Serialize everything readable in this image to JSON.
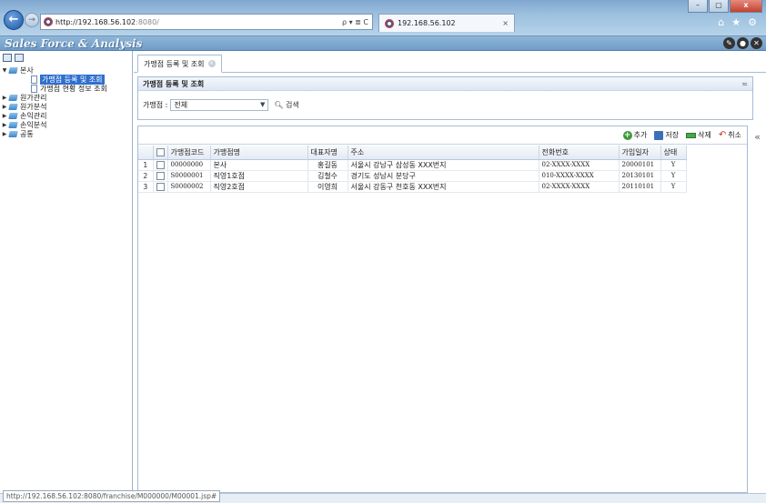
{
  "browser": {
    "url_host": "http://192.168.56.102",
    "url_port": ":8080/",
    "address_tools": "ρ ▾ ≣ C",
    "tab_title": "192.168.56.102",
    "tab_close": "×",
    "window_buttons": [
      "–",
      "▢",
      "x"
    ],
    "toolbar_icons": {
      "home": "⌂",
      "favorites": "★",
      "settings": "⚙"
    },
    "status_url": "http://192.168.56.102:8080/franchise/M000000/M00001.jsp#"
  },
  "app": {
    "title": "Sales Force & Analysis",
    "header_icons": {
      "edit": "✎",
      "user": "●",
      "close": "✕"
    }
  },
  "sidebar": {
    "tree": [
      {
        "label": "본사",
        "expanded": true,
        "children": [
          {
            "label": "가맹점 등록 및 조회",
            "selected": true
          },
          {
            "label": "가맹점 현황 정보 조회",
            "selected": false
          }
        ]
      },
      {
        "label": "원가관리",
        "expanded": false
      },
      {
        "label": "원가분석",
        "expanded": false
      },
      {
        "label": "손익관리",
        "expanded": false
      },
      {
        "label": "손익분석",
        "expanded": false
      },
      {
        "label": "공통",
        "expanded": false
      }
    ]
  },
  "main": {
    "tab_label": "가맹점 등록 및 조회",
    "panel_title": "가맹점 등록 및 조회",
    "collapse_symbol": "«",
    "panel_collapse_symbol": "≈",
    "filter": {
      "label": "가맹점 :",
      "selected": "전체",
      "search_label": "검색"
    },
    "toolbar": {
      "add": "추가",
      "save": "저장",
      "delete": "삭제",
      "cancel": "취소"
    },
    "table": {
      "columns": [
        "",
        "",
        "가맹점코드",
        "가맹점명",
        "대표자명",
        "주소",
        "전화번호",
        "가입일자",
        "상태"
      ],
      "rows": [
        {
          "no": "1",
          "code": "00000000",
          "name": "본사",
          "rep": "홍길동",
          "addr": "서울시 강남구 삼성동 XXX번지",
          "tel": "02-XXXX-XXXX",
          "joined": "20000101",
          "status": "Y"
        },
        {
          "no": "2",
          "code": "S0000001",
          "name": "직영1호점",
          "rep": "김철수",
          "addr": "경기도 성남시 분당구",
          "tel": "010-XXXX-XXXX",
          "joined": "20130101",
          "status": "Y"
        },
        {
          "no": "3",
          "code": "S0000002",
          "name": "직영2호점",
          "rep": "이영희",
          "addr": "서울시 강동구 천호동 XXX번지",
          "tel": "02-XXXX-XXXX",
          "joined": "20110101",
          "status": "Y"
        }
      ]
    }
  }
}
